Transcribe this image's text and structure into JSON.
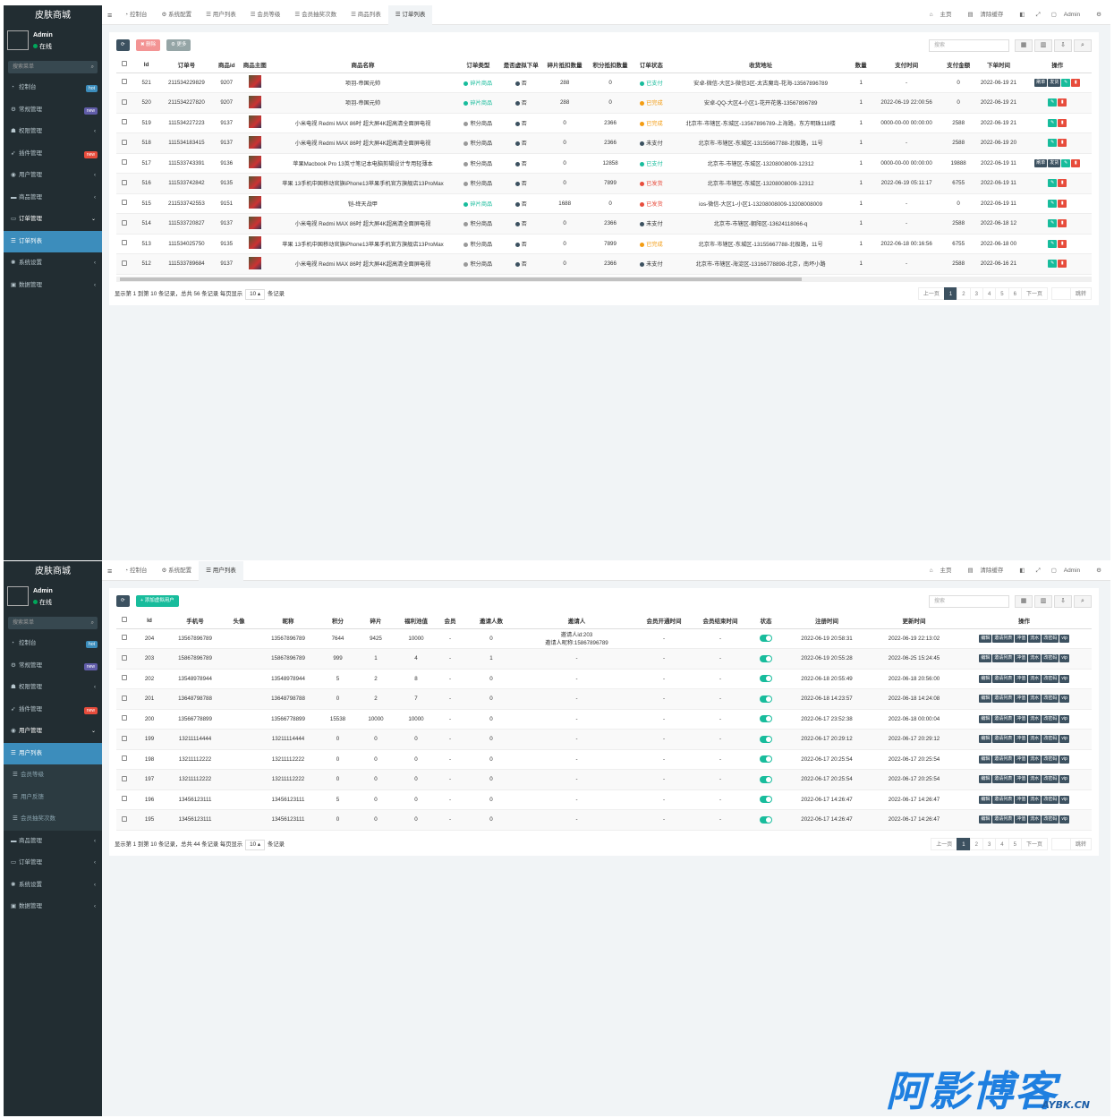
{
  "colors": {
    "sidebar": "#222d32",
    "accent": "#3c8dbc",
    "green": "#18bc9c",
    "red": "#e74c3c",
    "orange": "#f39c12",
    "dark": "#3c5160"
  },
  "panel1": {
    "logo": "皮肤商城",
    "user": {
      "name": "Admin",
      "status": "在线"
    },
    "search_placeholder": "搜索菜单",
    "menu": [
      {
        "label": "控制台",
        "icon": "dashboard-icon",
        "badge": "hot",
        "badge_color": "#3c8dbc"
      },
      {
        "label": "常规管理",
        "icon": "cogs-icon",
        "badge": "new",
        "badge_color": "#605ca8"
      },
      {
        "label": "权限管理",
        "icon": "group-icon",
        "arrow": "‹"
      },
      {
        "label": "插件管理",
        "icon": "rocket-icon",
        "badge": "new",
        "badge_color": "#e74c3c"
      },
      {
        "label": "用户管理",
        "icon": "user-circle-icon",
        "arrow": "‹"
      },
      {
        "label": "商品管理",
        "icon": "goods-icon",
        "arrow": "‹"
      },
      {
        "label": "订单管理",
        "icon": "order-icon",
        "arrow": "⌄",
        "open": true
      },
      {
        "label": "订单列表",
        "icon": "list-icon",
        "active": true
      },
      {
        "label": "系统设置",
        "icon": "settings-icon",
        "arrow": "‹"
      },
      {
        "label": "数据管理",
        "icon": "database-icon",
        "arrow": "‹"
      }
    ],
    "tabs": [
      "控制台",
      "系统配置",
      "用户列表",
      "会员等级",
      "会员抽奖次数",
      "商品列表",
      "订单列表"
    ],
    "top_right": [
      "主页",
      "清除缓存",
      "Admin"
    ],
    "toolbar": {
      "delete": "删除",
      "more": "更多"
    },
    "search_placeholder_table": "搜索",
    "columns": [
      "Id",
      "订单号",
      "商品id",
      "商品主图",
      "商品名称",
      "订单类型",
      "是否虚拟下单",
      "碎片抵扣数量",
      "积分抵扣数量",
      "订单状态",
      "收货地址",
      "数量",
      "支付时间",
      "支付金额",
      "下单时间",
      "操作"
    ],
    "rows": [
      {
        "id": "521",
        "order_no": "211534229829",
        "goods_id": "9207",
        "name": "项羽-帝国元帅",
        "type": "碎片商品",
        "type_color": "g",
        "virtual": "否",
        "frag": "288",
        "points": "0",
        "status": "已支付",
        "status_color": "g",
        "address": "安卓-微信-大区3-微信3区-太古魔岛-花海-13567896789",
        "qty": "1",
        "pay_time": "-",
        "amount": "0",
        "order_time": "2022-06-19 21",
        "actions": [
          "刷单",
          "发货"
        ]
      },
      {
        "id": "520",
        "order_no": "211534227820",
        "goods_id": "9207",
        "name": "项羽-帝国元帅",
        "type": "碎片商品",
        "type_color": "g",
        "virtual": "否",
        "frag": "288",
        "points": "0",
        "status": "已完成",
        "status_color": "o",
        "address": "安卓-QQ-大区4-小区1-花开花落-13567896789",
        "qty": "1",
        "pay_time": "2022-06-19 22:00:56",
        "amount": "0",
        "order_time": "2022-06-19 21",
        "actions": []
      },
      {
        "id": "519",
        "order_no": "111534227223",
        "goods_id": "9137",
        "name": "小米电视 Redmi MAX 86吋 超大屏4K超高清全面屏电视",
        "type": "积分商品",
        "type_color": "dk",
        "virtual": "否",
        "frag": "0",
        "points": "2366",
        "status": "已完成",
        "status_color": "o",
        "address": "北京市-市辖区-东城区-13567896789-上海路，东方明珠118楼",
        "qty": "1",
        "pay_time": "0000-00-00 00:00:00",
        "amount": "2588",
        "order_time": "2022-06-19 21",
        "actions": []
      },
      {
        "id": "518",
        "order_no": "111534183415",
        "goods_id": "9137",
        "name": "小米电视 Redmi MAX 86吋 超大屏4K超高清全面屏电视",
        "type": "积分商品",
        "type_color": "dk",
        "virtual": "否",
        "frag": "0",
        "points": "2366",
        "status": "未支付",
        "status_color": "dk",
        "address": "北京市-市辖区-东城区-13155667788-北极路，11号",
        "qty": "1",
        "pay_time": "-",
        "amount": "2588",
        "order_time": "2022-06-19 20",
        "actions": []
      },
      {
        "id": "517",
        "order_no": "111533743391",
        "goods_id": "9136",
        "name": "苹果Macbook Pro 13英寸笔记本电脑剪辑设计专用轻薄本",
        "type": "积分商品",
        "type_color": "dk",
        "virtual": "否",
        "frag": "0",
        "points": "12858",
        "status": "已支付",
        "status_color": "g",
        "address": "北京市-市辖区-东城区-13208008009-12312",
        "qty": "1",
        "pay_time": "0000-00-00 00:00:00",
        "amount": "19888",
        "order_time": "2022-06-19 11",
        "actions": [
          "刷单",
          "发货"
        ]
      },
      {
        "id": "516",
        "order_no": "111533742842",
        "goods_id": "9135",
        "name": "苹果 13手机中国移动官旗iPhone13苹果手机官方旗舰店13ProMax",
        "type": "积分商品",
        "type_color": "dk",
        "virtual": "否",
        "frag": "0",
        "points": "7899",
        "status": "已发货",
        "status_color": "r",
        "address": "北京市-市辖区-东城区-13208008009-12312",
        "qty": "1",
        "pay_time": "2022-06-19 05:11:17",
        "amount": "6755",
        "order_time": "2022-06-19 11",
        "actions": []
      },
      {
        "id": "515",
        "order_no": "211533742553",
        "goods_id": "9151",
        "name": "铠-绛天战甲",
        "type": "碎片商品",
        "type_color": "g",
        "virtual": "否",
        "frag": "1688",
        "points": "0",
        "status": "已发货",
        "status_color": "r",
        "address": "ios-微信-大区1-小区1-13208008009-13208008009",
        "qty": "1",
        "pay_time": "-",
        "amount": "0",
        "order_time": "2022-06-19 11",
        "actions": []
      },
      {
        "id": "514",
        "order_no": "111533720827",
        "goods_id": "9137",
        "name": "小米电视 Redmi MAX 86吋 超大屏4K超高清全面屏电视",
        "type": "积分商品",
        "type_color": "dk",
        "virtual": "否",
        "frag": "0",
        "points": "2366",
        "status": "未支付",
        "status_color": "dk",
        "address": "北京市-市辖区-朝阳区-13624118066-q",
        "qty": "1",
        "pay_time": "-",
        "amount": "2588",
        "order_time": "2022-06-18 12",
        "actions": []
      },
      {
        "id": "513",
        "order_no": "111534025750",
        "goods_id": "9135",
        "name": "苹果 13手机中国移动官旗iPhone13苹果手机官方旗舰店13ProMax",
        "type": "积分商品",
        "type_color": "dk",
        "virtual": "否",
        "frag": "0",
        "points": "7899",
        "status": "已完成",
        "status_color": "o",
        "address": "北京市-市辖区-东城区-13155667788-北极路，11号",
        "qty": "1",
        "pay_time": "2022-06-18 00:16:56",
        "amount": "6755",
        "order_time": "2022-06-18 00",
        "actions": []
      },
      {
        "id": "512",
        "order_no": "111533789684",
        "goods_id": "9137",
        "name": "小米电视 Redmi MAX 86吋 超大屏4K超高清全面屏电视",
        "type": "积分商品",
        "type_color": "dk",
        "virtual": "否",
        "frag": "0",
        "points": "2366",
        "status": "未支付",
        "status_color": "dk",
        "address": "北京市-市辖区-海淀区-13166778898-北京，南坏小路",
        "qty": "1",
        "pay_time": "-",
        "amount": "2588",
        "order_time": "2022-06-16 21",
        "actions": []
      }
    ],
    "footer": {
      "pre": "显示第 1 到第 10 条记录，总共 56 条记录 每页显示",
      "page_size": "10 ▴",
      "post": "条记录"
    },
    "pager": [
      "上一页",
      "1",
      "2",
      "3",
      "4",
      "5",
      "6",
      "下一页",
      "",
      "跳转"
    ]
  },
  "panel2": {
    "logo": "皮肤商城",
    "user": {
      "name": "Admin",
      "status": "在线"
    },
    "search_placeholder": "搜索菜单",
    "menu": [
      {
        "label": "控制台",
        "icon": "dashboard-icon",
        "badge": "hot",
        "badge_color": "#3c8dbc"
      },
      {
        "label": "常规管理",
        "icon": "cogs-icon",
        "badge": "new",
        "badge_color": "#605ca8"
      },
      {
        "label": "权限管理",
        "icon": "group-icon",
        "arrow": "‹"
      },
      {
        "label": "插件管理",
        "icon": "rocket-icon",
        "badge": "new",
        "badge_color": "#e74c3c"
      },
      {
        "label": "用户管理",
        "icon": "user-circle-icon",
        "arrow": "⌄",
        "open": true
      },
      {
        "label": "用户列表",
        "icon": "list-icon",
        "active": true
      },
      {
        "label": "会员等级",
        "icon": "list-icon",
        "sub": true
      },
      {
        "label": "用户反馈",
        "icon": "list-icon",
        "sub": true
      },
      {
        "label": "会员抽奖次数",
        "icon": "list-icon",
        "sub": true
      },
      {
        "label": "商品管理",
        "icon": "goods-icon",
        "arrow": "‹"
      },
      {
        "label": "订单管理",
        "icon": "order-icon",
        "arrow": "‹"
      },
      {
        "label": "系统设置",
        "icon": "settings-icon",
        "arrow": "‹"
      },
      {
        "label": "数据管理",
        "icon": "database-icon",
        "arrow": "‹"
      }
    ],
    "tabs": [
      "控制台",
      "系统配置",
      "用户列表"
    ],
    "top_right": [
      "主页",
      "清除缓存",
      "Admin"
    ],
    "toolbar": {
      "add": "添加虚拟用户"
    },
    "search_placeholder_table": "搜索",
    "columns": [
      "Id",
      "手机号",
      "头像",
      "昵称",
      "积分",
      "碎片",
      "福利池值",
      "会员",
      "邀请人数",
      "邀请人",
      "会员开通时间",
      "会员结束时间",
      "状态",
      "注册时间",
      "更新时间",
      "操作"
    ],
    "row_actions": [
      "编辑",
      "邀请列表",
      "冲值",
      "流水",
      "改密码",
      "vip"
    ],
    "rows": [
      {
        "id": "204",
        "phone": "13567896789",
        "avatar": "",
        "nick": "13567896789",
        "points": "7644",
        "frag": "9425",
        "pool": "10000",
        "vip": "-",
        "invites": "0",
        "inviter": "邀请人id:203",
        "inviter2": "邀请人昵称:15867896789",
        "vip_start": "-",
        "vip_end": "-",
        "reg": "2022-06-19 20:58:31",
        "upd": "2022-06-19 22:13:02"
      },
      {
        "id": "203",
        "phone": "15867896789",
        "avatar": "",
        "nick": "15867896789",
        "points": "999",
        "frag": "1",
        "pool": "4",
        "vip": "-",
        "invites": "1",
        "inviter": "-",
        "inviter2": "",
        "vip_start": "-",
        "vip_end": "-",
        "reg": "2022-06-19 20:55:28",
        "upd": "2022-06-25 15:24:45"
      },
      {
        "id": "202",
        "phone": "13548978944",
        "avatar": "",
        "nick": "13548978944",
        "points": "5",
        "frag": "2",
        "pool": "8",
        "vip": "-",
        "invites": "0",
        "inviter": "-",
        "inviter2": "",
        "vip_start": "-",
        "vip_end": "-",
        "reg": "2022-06-18 20:55:49",
        "upd": "2022-06-18 20:56:00"
      },
      {
        "id": "201",
        "phone": "13648798788",
        "avatar": "",
        "nick": "13648798788",
        "points": "0",
        "frag": "2",
        "pool": "7",
        "vip": "-",
        "invites": "0",
        "inviter": "-",
        "inviter2": "",
        "vip_start": "-",
        "vip_end": "-",
        "reg": "2022-06-18 14:23:57",
        "upd": "2022-06-18 14:24:08"
      },
      {
        "id": "200",
        "phone": "13566778899",
        "avatar": "",
        "nick": "13566778899",
        "points": "15538",
        "frag": "10000",
        "pool": "10000",
        "vip": "-",
        "invites": "0",
        "inviter": "-",
        "inviter2": "",
        "vip_start": "-",
        "vip_end": "-",
        "reg": "2022-06-17 23:52:38",
        "upd": "2022-06-18 00:00:04"
      },
      {
        "id": "199",
        "phone": "13211114444",
        "avatar": "",
        "nick": "13211114444",
        "points": "0",
        "frag": "0",
        "pool": "0",
        "vip": "-",
        "invites": "0",
        "inviter": "-",
        "inviter2": "",
        "vip_start": "-",
        "vip_end": "-",
        "reg": "2022-06-17 20:29:12",
        "upd": "2022-06-17 20:29:12"
      },
      {
        "id": "198",
        "phone": "13211112222",
        "avatar": "",
        "nick": "13211112222",
        "points": "0",
        "frag": "0",
        "pool": "0",
        "vip": "-",
        "invites": "0",
        "inviter": "-",
        "inviter2": "",
        "vip_start": "-",
        "vip_end": "-",
        "reg": "2022-06-17 20:25:54",
        "upd": "2022-06-17 20:25:54"
      },
      {
        "id": "197",
        "phone": "13211112222",
        "avatar": "",
        "nick": "13211112222",
        "points": "0",
        "frag": "0",
        "pool": "0",
        "vip": "-",
        "invites": "0",
        "inviter": "-",
        "inviter2": "",
        "vip_start": "-",
        "vip_end": "-",
        "reg": "2022-06-17 20:25:54",
        "upd": "2022-06-17 20:25:54"
      },
      {
        "id": "196",
        "phone": "13456123111",
        "avatar": "",
        "nick": "13456123111",
        "points": "5",
        "frag": "0",
        "pool": "0",
        "vip": "-",
        "invites": "0",
        "inviter": "-",
        "inviter2": "",
        "vip_start": "-",
        "vip_end": "-",
        "reg": "2022-06-17 14:26:47",
        "upd": "2022-06-17 14:26:47"
      },
      {
        "id": "195",
        "phone": "13456123111",
        "avatar": "",
        "nick": "13456123111",
        "points": "0",
        "frag": "0",
        "pool": "0",
        "vip": "-",
        "invites": "0",
        "inviter": "-",
        "inviter2": "",
        "vip_start": "-",
        "vip_end": "-",
        "reg": "2022-06-17 14:26:47",
        "upd": "2022-06-17 14:26:47"
      }
    ],
    "footer": {
      "pre": "显示第 1 到第 10 条记录，总共 44 条记录 每页显示",
      "page_size": "10 ▴",
      "post": "条记录"
    },
    "pager": [
      "上一页",
      "1",
      "2",
      "3",
      "4",
      "5",
      "下一页",
      "",
      "跳转"
    ]
  },
  "watermark": {
    "big": "阿影博客",
    "small": "AYBK.CN"
  }
}
